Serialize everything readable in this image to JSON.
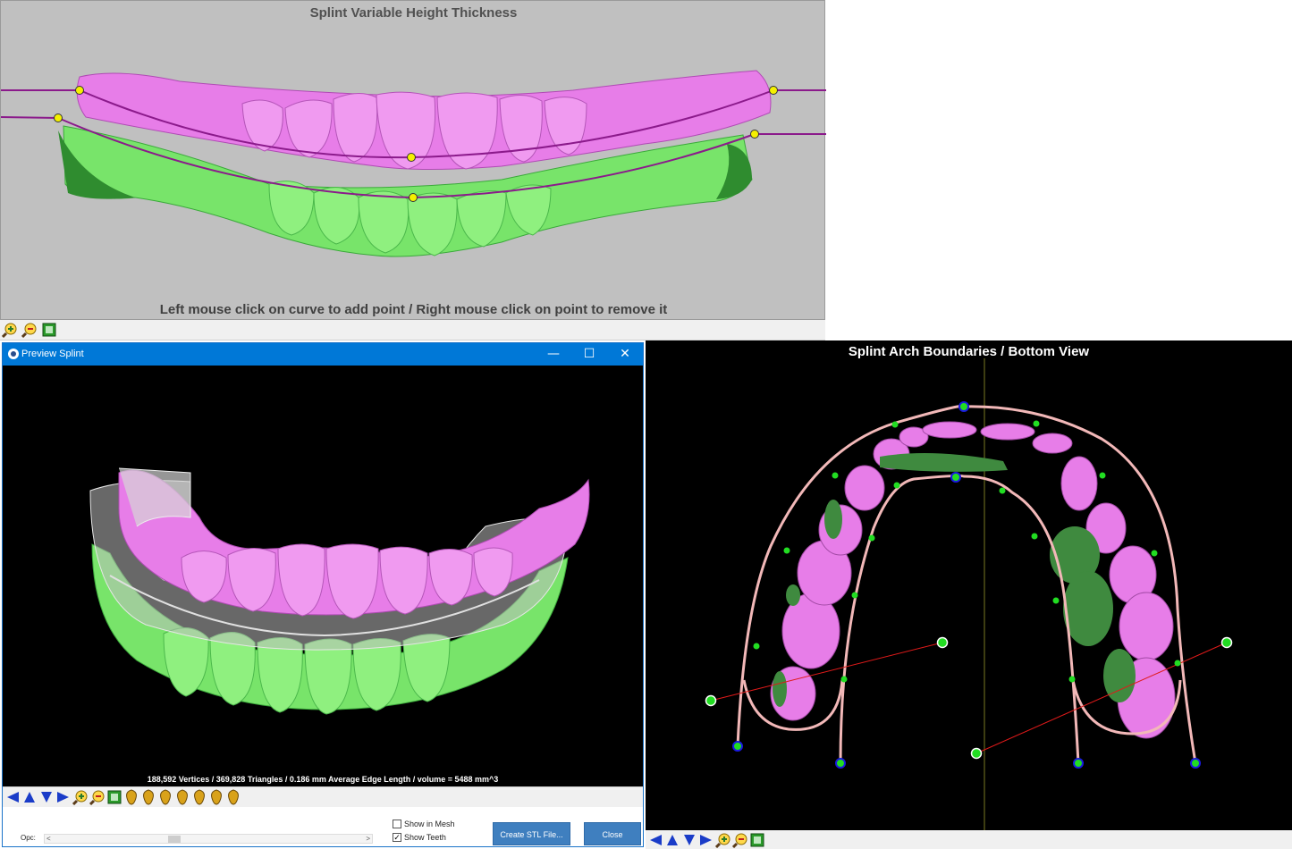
{
  "top_panel": {
    "title": "Splint Variable Height Thickness",
    "hint": "Left mouse click on curve to add point / Right mouse click on point to remove it",
    "toolbar_icons": [
      "zoom-in-icon",
      "zoom-out-icon",
      "fit-view-icon"
    ]
  },
  "preview_window": {
    "title": "Preview Splint",
    "controls": {
      "minimize": "—",
      "maximize": "☐",
      "close": "✕"
    },
    "stats": "188,592 Vertices / 369,828 Triangles / 0.186 mm Average Edge Length / volume = 5488 mm^3",
    "toolbar_icons": [
      "arrow-left-icon",
      "arrow-up-icon",
      "arrow-down-icon",
      "arrow-right-icon",
      "zoom-in-icon",
      "zoom-out-icon",
      "fit-view-icon",
      "tooth-view-1-icon",
      "tooth-view-2-icon",
      "tooth-view-3-icon",
      "tooth-view-4-icon",
      "tooth-view-5-icon",
      "tooth-view-6-icon",
      "tooth-view-7-icon"
    ],
    "show_in_mesh": {
      "label": "Show in Mesh",
      "checked": false
    },
    "show_teeth": {
      "label": "Show Teeth",
      "checked": true
    },
    "create_stl_button": "Create STL File...",
    "close_button": "Close",
    "opacity": {
      "label": "Opc:",
      "left_arrow": "<",
      "right_arrow": ">",
      "value": 0.38
    }
  },
  "arch_panel": {
    "title": "Splint Arch Boundaries / Bottom View",
    "toolbar_icons": [
      "arrow-left-icon",
      "arrow-up-icon",
      "arrow-down-icon",
      "arrow-right-icon",
      "zoom-in-icon",
      "zoom-out-icon",
      "fit-view-icon"
    ]
  },
  "colors": {
    "pink_teeth": "#e77de8",
    "green_teeth": "#7fe86f",
    "curve": "#8b1a8b",
    "control_point": "#f5f000",
    "arch_boundary": "#f2b8b8",
    "boundary_point": "#22dd22",
    "titlebar": "#0078d7"
  }
}
